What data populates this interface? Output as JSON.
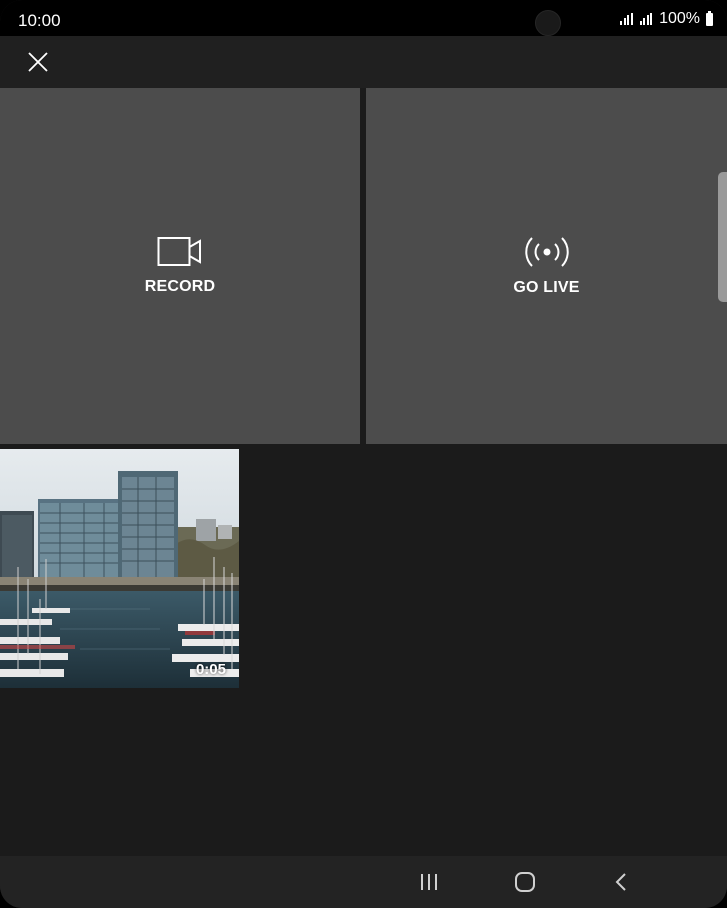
{
  "status_bar": {
    "time": "10:00",
    "battery": "100%"
  },
  "app_bar": {
    "close_icon": "close-icon"
  },
  "tiles": {
    "record": {
      "label": "RECORD",
      "icon": "video-camera-icon"
    },
    "go_live": {
      "label": "GO LIVE",
      "icon": "broadcast-icon"
    }
  },
  "videos": [
    {
      "duration": "0:05"
    }
  ],
  "nav_bar": {
    "recents_icon": "recents-icon",
    "home_icon": "home-icon",
    "back_icon": "back-icon"
  },
  "colors": {
    "background": "#1b1b1b",
    "tile": "#4c4c4c",
    "app_bar": "#202020",
    "nav_bar": "#232323"
  }
}
